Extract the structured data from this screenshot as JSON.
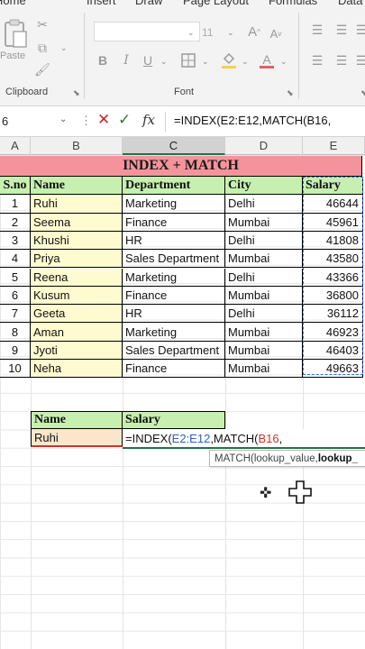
{
  "ribbon": {
    "tabs": [
      "Home",
      "Insert",
      "Draw",
      "Page Layout",
      "Formulas",
      "Data"
    ],
    "active_tab": "Home",
    "groups": {
      "clipboard": "Clipboard",
      "font": "Font"
    },
    "paste_label": "Paste",
    "font_size": "11"
  },
  "formula_bar": {
    "name_box": "6",
    "fx": "fx",
    "formula": "=INDEX(E2:E12,MATCH(B16,"
  },
  "columns": [
    "A",
    "B",
    "C",
    "D",
    "E"
  ],
  "selected_column": "C",
  "table": {
    "title": "INDEX + MATCH",
    "headers": [
      "S.no",
      "Name",
      "Department",
      "City",
      "Salary"
    ],
    "rows": [
      [
        "1",
        "Ruhi",
        "Marketing",
        "Delhi",
        "46644"
      ],
      [
        "2",
        "Seema",
        "Finance",
        "Mumbai",
        "45961"
      ],
      [
        "3",
        "Khushi",
        "HR",
        "Delhi",
        "41808"
      ],
      [
        "4",
        "Priya",
        "Sales Department",
        "Mumbai",
        "43580"
      ],
      [
        "5",
        "Reena",
        "Marketing",
        "Delhi",
        "43366"
      ],
      [
        "6",
        "Kusum",
        "Finance",
        "Mumbai",
        "36800"
      ],
      [
        "7",
        "Geeta",
        "HR",
        "Delhi",
        "36112"
      ],
      [
        "8",
        "Aman",
        "Marketing",
        "Mumbai",
        "46923"
      ],
      [
        "9",
        "Jyoti",
        "Sales Department",
        "Mumbai",
        "46403"
      ],
      [
        "10",
        "Neha",
        "Finance",
        "Mumbai",
        "49663"
      ]
    ]
  },
  "lookup": {
    "headers": [
      "Name",
      "Salary"
    ],
    "name_value": "Ruhi",
    "formula_prefix": "=INDEX(",
    "formula_range": "E2:E12",
    "formula_mid": ",MATCH(",
    "formula_ref": "B16",
    "formula_suffix": ","
  },
  "tooltip": {
    "text": "MATCH(lookup_value, ",
    "bold": "lookup_"
  }
}
